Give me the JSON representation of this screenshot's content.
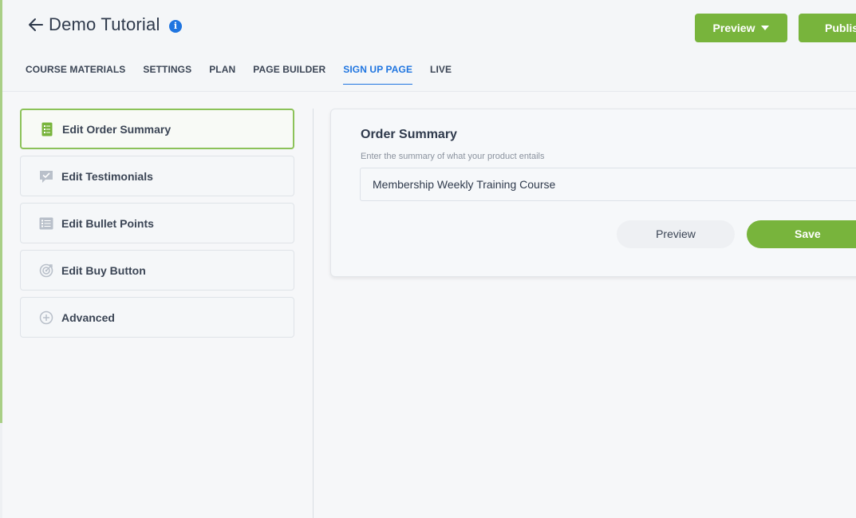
{
  "header": {
    "title": "Demo Tutorial",
    "info_icon": "i",
    "preview_label": "Preview",
    "publish_label": "Publis"
  },
  "tabs": [
    {
      "label": "COURSE MATERIALS"
    },
    {
      "label": "SETTINGS"
    },
    {
      "label": "PLAN"
    },
    {
      "label": "PAGE BUILDER"
    },
    {
      "label": "SIGN UP PAGE",
      "active": true
    },
    {
      "label": "LIVE"
    }
  ],
  "sidebar": {
    "items": [
      {
        "label": "Edit Order Summary",
        "icon": "order-list-icon",
        "active": true
      },
      {
        "label": "Edit Testimonials",
        "icon": "chat-check-icon"
      },
      {
        "label": "Edit Bullet Points",
        "icon": "bullet-list-icon"
      },
      {
        "label": "Edit Buy Button",
        "icon": "target-icon"
      },
      {
        "label": "Advanced",
        "icon": "plus-circle-icon"
      }
    ]
  },
  "card": {
    "title": "Order Summary",
    "hint": "Enter the summary of what your product entails",
    "input_value": "Membership Weekly Training Course",
    "preview_label": "Preview",
    "save_label": "Save"
  },
  "colors": {
    "accent_green": "#78b43c",
    "accent_blue": "#1f75e0",
    "active_border": "#8cc259"
  }
}
